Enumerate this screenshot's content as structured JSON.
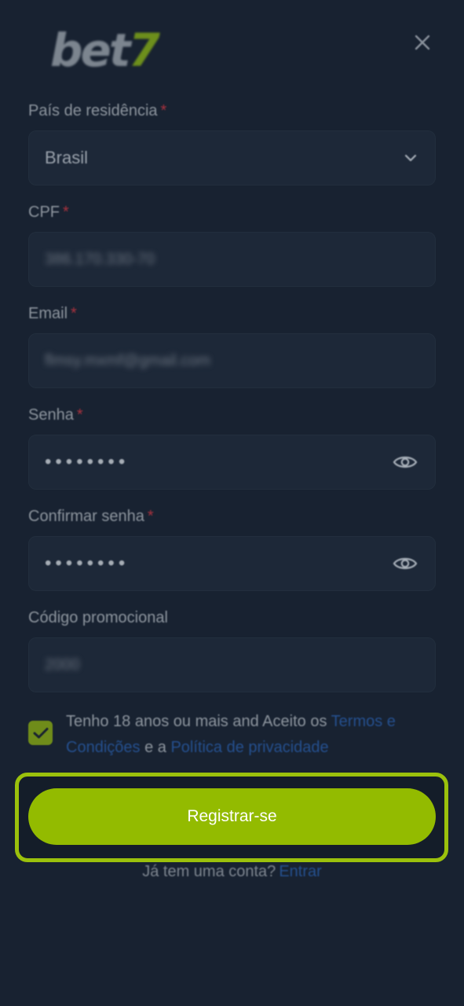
{
  "header": {
    "logo_main": "bet",
    "logo_accent": "7",
    "close_icon": "close-icon"
  },
  "form": {
    "country": {
      "label": "País de residência",
      "required_mark": "*",
      "value": "Brasil",
      "icon": "chevron-down-icon"
    },
    "cpf": {
      "label": "CPF",
      "required_mark": "*",
      "value": "386.170.330-70"
    },
    "email": {
      "label": "Email",
      "required_mark": "*",
      "value": "flmsy.mxmf@gmail.com"
    },
    "password": {
      "label": "Senha",
      "required_mark": "*",
      "value": "••••••••",
      "icon": "eye-icon"
    },
    "confirm_password": {
      "label": "Confirmar senha",
      "required_mark": "*",
      "value": "••••••••",
      "icon": "eye-icon"
    },
    "promo_code": {
      "label": "Código promocional",
      "value": "2000"
    }
  },
  "terms": {
    "checked": true,
    "text_before": "Tenho 18 anos ou mais and Aceito os ",
    "terms_link": "Termos e Condições",
    "text_middle": " e a ",
    "privacy_link": "Política de privacidade"
  },
  "register_button": "Registrar-se",
  "login": {
    "prompt": "Já tem uma conta?",
    "link": "Entrar"
  },
  "colors": {
    "background": "#182231",
    "accent": "#93bb00",
    "highlight_border": "#9bc10c",
    "link": "#25508f",
    "required": "#a8323e"
  }
}
